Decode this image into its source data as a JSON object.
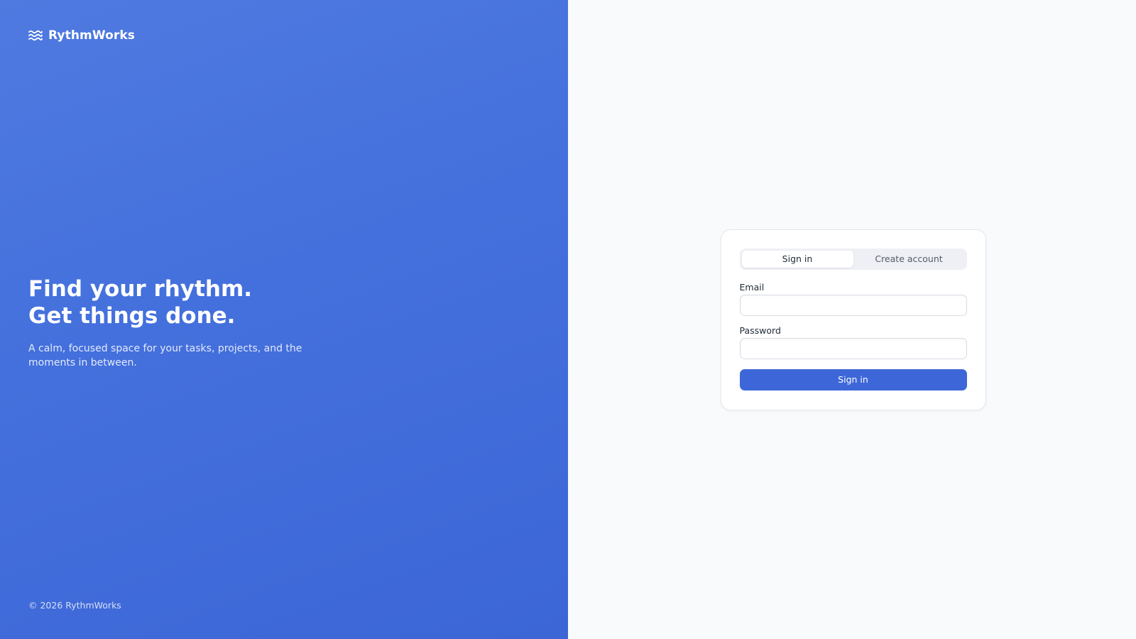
{
  "brand": {
    "name": "RythmWorks",
    "icon": "waves-icon"
  },
  "hero": {
    "title_line1": "Find your rhythm.",
    "title_line2": "Get things done.",
    "tagline": "A calm, focused space for your tasks, projects, and the moments in between."
  },
  "footer": {
    "copyright": "© 2026 RythmWorks"
  },
  "auth": {
    "tabs": [
      {
        "label": "Sign in",
        "active": true
      },
      {
        "label": "Create account",
        "active": false
      }
    ],
    "email": {
      "label": "Email",
      "value": "",
      "placeholder": ""
    },
    "password": {
      "label": "Password",
      "value": "",
      "placeholder": ""
    },
    "submit_label": "Sign in"
  },
  "colors": {
    "brand_panel": "#4470dd",
    "accent_button": "#3d67d8",
    "page_background": "#f9fafc"
  }
}
